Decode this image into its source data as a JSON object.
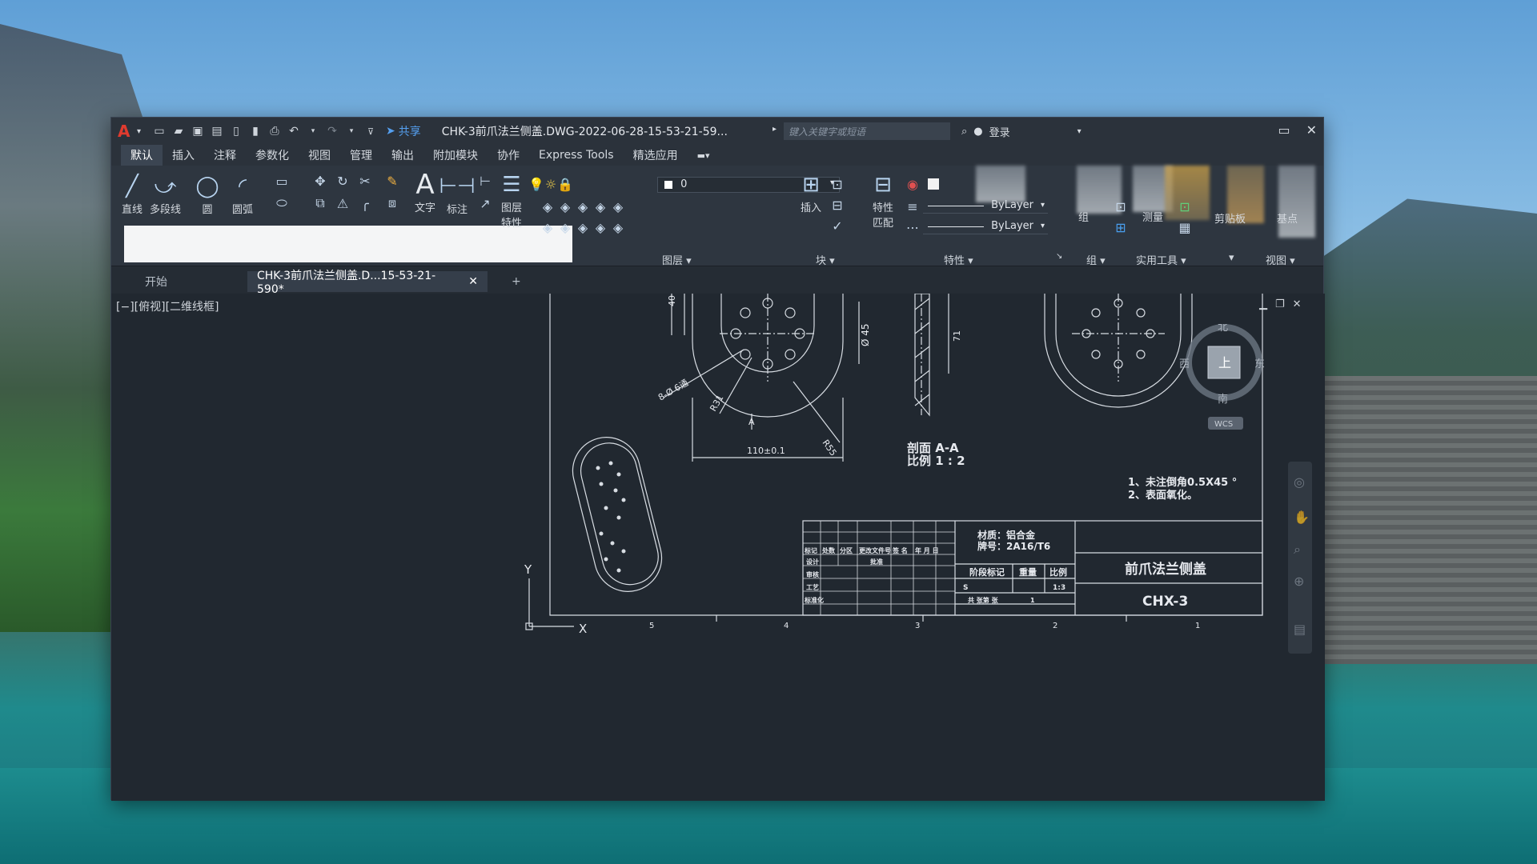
{
  "window": {
    "title": "CHK-3前爪法兰侧盖.DWG-2022-06-28-15-53-21-59...",
    "share_label": "共享",
    "search_placeholder": "键入关键字或短语",
    "login_label": "登录"
  },
  "menu": {
    "tabs": [
      "默认",
      "插入",
      "注释",
      "参数化",
      "视图",
      "管理",
      "输出",
      "附加模块",
      "协作",
      "Express Tools",
      "精选应用"
    ],
    "active_index": 0
  },
  "ribbon": {
    "draw_tools": [
      "直线",
      "多段线",
      "圆",
      "圆弧"
    ],
    "text_label": "文字",
    "dim_label": "标注",
    "layer_props_label_1": "图层",
    "layer_props_label_2": "特性",
    "layer_value": "0",
    "layer_panel_label": "图层",
    "insert_label": "插入",
    "block_panel_label": "块",
    "match_label_1": "特性",
    "match_label_2": "匹配",
    "bylayer_1": "ByLayer",
    "bylayer_2": "ByLayer",
    "props_panel_label": "特性",
    "group_label": "组",
    "group_panel_label": "组",
    "measure_label": "测量",
    "utilities_panel_label": "实用工具",
    "clipboard_label": "剪贴板",
    "base_label": "基点",
    "view_panel_label": "视图"
  },
  "doc_tabs": {
    "start": "开始",
    "active": "CHK-3前爪法兰侧盖.D...15-53-21-590*",
    "add": "+"
  },
  "viewport": {
    "label": "[−][俯视][二维线框]",
    "viewcube": {
      "north": "北",
      "south": "南",
      "east": "东",
      "west": "西",
      "top": "上",
      "wcs": "WCS"
    }
  },
  "drawing": {
    "dim_40": "40",
    "dim_45": "Ø 45",
    "dim_71": "71",
    "holes": "8-Ø 6通",
    "r31": "R31",
    "r55": "R55",
    "a_mark": "A",
    "width": "110±0.1",
    "section": "剖面 A-A",
    "scale": "比例 1 : 2",
    "note_1": "1、未注倒角0.5X45 °",
    "note_2": "2、表面氧化。",
    "material": "材质：铝合金",
    "grade": "牌号：2A16/T6",
    "part_name": "前爪法兰侧盖",
    "part_code": "CHX-3",
    "tb_headers": [
      "标记",
      "处数",
      "分区",
      "更改文件号",
      "签 名",
      "年 月 日"
    ],
    "tb_rows": [
      "设计",
      "审核",
      "工艺",
      "标准化"
    ],
    "tb_approve": "批准",
    "stage_label": "阶段标记",
    "weight_label": "重量",
    "ratio_label": "比例",
    "stage_s": "S",
    "ratio_value": "1:3",
    "sheets": "共    张第    张",
    "sheet_no": "1",
    "zone_numbers": [
      "5",
      "4",
      "3",
      "2",
      "1"
    ],
    "axis_y": "Y",
    "axis_x": "X"
  }
}
